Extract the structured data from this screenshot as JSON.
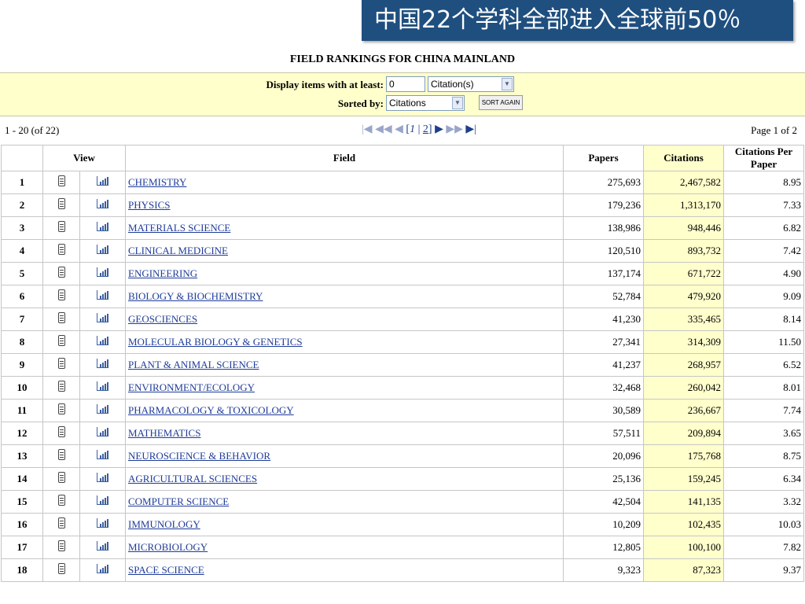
{
  "banner": {
    "text": "中国22个学科全部进入全球前50％"
  },
  "page_title": "FIELD RANKINGS FOR CHINA MAINLAND",
  "options": {
    "display_label": "Display items with at least:",
    "threshold_value": "0",
    "threshold_unit": "Citation(s)",
    "sort_label": "Sorted by:",
    "sort_value": "Citations",
    "sort_button": "SORT AGAIN"
  },
  "pager": {
    "range": "1 - 20 (of 22)",
    "page_info": "Page 1 of 2",
    "pages": [
      "1",
      "2"
    ],
    "current_page": "1"
  },
  "table": {
    "headers": {
      "rank": "",
      "view": "View",
      "field": "Field",
      "papers": "Papers",
      "citations": "Citations",
      "cpp": "Citations Per Paper"
    },
    "rows": [
      {
        "rank": "1",
        "field": "CHEMISTRY",
        "papers": "275,693",
        "citations": "2,467,582",
        "cpp": "8.95"
      },
      {
        "rank": "2",
        "field": "PHYSICS",
        "papers": "179,236",
        "citations": "1,313,170",
        "cpp": "7.33"
      },
      {
        "rank": "3",
        "field": "MATERIALS SCIENCE",
        "papers": "138,986",
        "citations": "948,446",
        "cpp": "6.82"
      },
      {
        "rank": "4",
        "field": "CLINICAL MEDICINE",
        "papers": "120,510",
        "citations": "893,732",
        "cpp": "7.42"
      },
      {
        "rank": "5",
        "field": "ENGINEERING",
        "papers": "137,174",
        "citations": "671,722",
        "cpp": "4.90"
      },
      {
        "rank": "6",
        "field": "BIOLOGY & BIOCHEMISTRY",
        "papers": "52,784",
        "citations": "479,920",
        "cpp": "9.09"
      },
      {
        "rank": "7",
        "field": "GEOSCIENCES",
        "papers": "41,230",
        "citations": "335,465",
        "cpp": "8.14"
      },
      {
        "rank": "8",
        "field": "MOLECULAR BIOLOGY & GENETICS",
        "papers": "27,341",
        "citations": "314,309",
        "cpp": "11.50"
      },
      {
        "rank": "9",
        "field": "PLANT & ANIMAL SCIENCE",
        "papers": "41,237",
        "citations": "268,957",
        "cpp": "6.52"
      },
      {
        "rank": "10",
        "field": "ENVIRONMENT/ECOLOGY",
        "papers": "32,468",
        "citations": "260,042",
        "cpp": "8.01"
      },
      {
        "rank": "11",
        "field": "PHARMACOLOGY & TOXICOLOGY",
        "papers": "30,589",
        "citations": "236,667",
        "cpp": "7.74"
      },
      {
        "rank": "12",
        "field": "MATHEMATICS",
        "papers": "57,511",
        "citations": "209,894",
        "cpp": "3.65"
      },
      {
        "rank": "13",
        "field": "NEUROSCIENCE & BEHAVIOR",
        "papers": "20,096",
        "citations": "175,768",
        "cpp": "8.75"
      },
      {
        "rank": "14",
        "field": "AGRICULTURAL SCIENCES",
        "papers": "25,136",
        "citations": "159,245",
        "cpp": "6.34"
      },
      {
        "rank": "15",
        "field": "COMPUTER SCIENCE",
        "papers": "42,504",
        "citations": "141,135",
        "cpp": "3.32"
      },
      {
        "rank": "16",
        "field": "IMMUNOLOGY",
        "papers": "10,209",
        "citations": "102,435",
        "cpp": "10.03"
      },
      {
        "rank": "17",
        "field": "MICROBIOLOGY",
        "papers": "12,805",
        "citations": "100,100",
        "cpp": "7.82"
      },
      {
        "rank": "18",
        "field": "SPACE SCIENCE",
        "papers": "9,323",
        "citations": "87,323",
        "cpp": "9.37"
      }
    ]
  },
  "icons": {
    "record": "document-icon",
    "chart": "bar-chart-icon",
    "nav_first": "first-page-icon",
    "nav_prev_fast": "rewind-icon",
    "nav_prev": "prev-icon",
    "nav_next": "next-icon",
    "nav_next_fast": "fast-forward-icon",
    "nav_last": "last-page-icon"
  },
  "colors": {
    "banner_bg": "#1f4f7f",
    "options_bg": "#ffffcc",
    "link": "#1f3c99",
    "citations_highlight": "#ffffcc"
  }
}
